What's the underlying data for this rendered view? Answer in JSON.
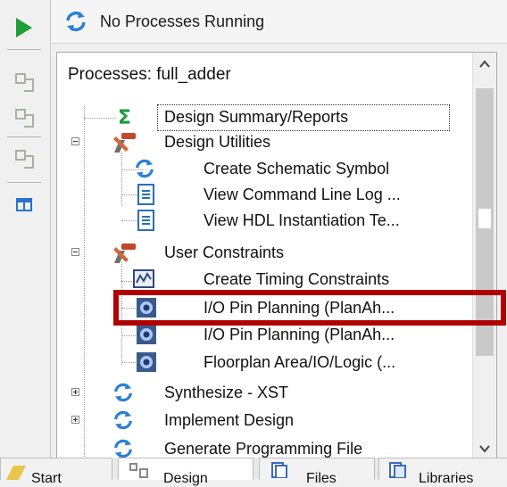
{
  "status": {
    "text": "No Processes Running"
  },
  "panel": {
    "title": "Processes: full_adder"
  },
  "tree": [
    {
      "label": "Design Summary/Reports",
      "icon": "sigma-icon"
    },
    {
      "label": "Design Utilities",
      "icon": "tools-icon"
    },
    {
      "label": "Create Schematic Symbol",
      "icon": "refresh-icon"
    },
    {
      "label": "View Command Line Log ...",
      "icon": "document-icon"
    },
    {
      "label": "View HDL Instantiation Te...",
      "icon": "document-icon"
    },
    {
      "label": "User Constraints",
      "icon": "tools-icon"
    },
    {
      "label": "Create Timing Constraints",
      "icon": "timing-icon"
    },
    {
      "label": "I/O Pin Planning (PlanAh...",
      "icon": "planahead-icon"
    },
    {
      "label": "I/O Pin Planning (PlanAh...",
      "icon": "planahead-icon"
    },
    {
      "label": "Floorplan Area/IO/Logic (...",
      "icon": "planahead-icon"
    },
    {
      "label": "Synthesize - XST",
      "icon": "refresh-icon"
    },
    {
      "label": "Implement Design",
      "icon": "refresh-icon"
    },
    {
      "label": "Generate Programming File",
      "icon": "refresh-icon"
    }
  ],
  "tabs": [
    "Start",
    "Design",
    "Files",
    "Libraries"
  ],
  "colors": {
    "highlight": "#b00000",
    "accent_green": "#1f9e3a",
    "accent_blue": "#2a74c8"
  }
}
